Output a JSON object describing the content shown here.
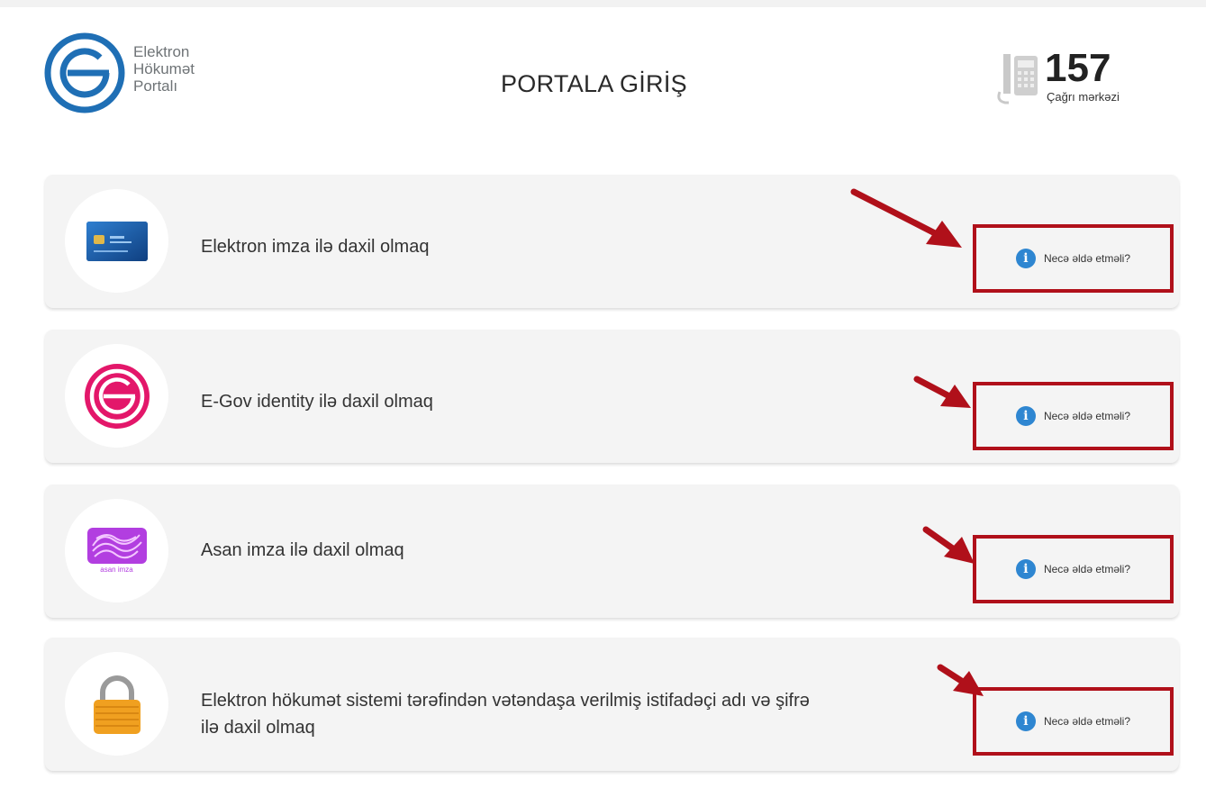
{
  "header": {
    "logo_lines": [
      "Elektron",
      "Hökumət",
      "Portalı"
    ],
    "title": "PORTALA GİRİŞ",
    "callcenter_number": "157",
    "callcenter_label": "Çağrı mərkəzi"
  },
  "login_options": [
    {
      "label": "Elektron imza ilə daxil olmaq",
      "icon": "smart-card-icon",
      "help_label": "Necə əldə etməli?"
    },
    {
      "label": "E-Gov identity ilə daxil olmaq",
      "icon": "egov-identity-icon",
      "help_label": "Necə əldə etməli?"
    },
    {
      "label": "Asan imza ilə daxil olmaq",
      "icon": "asan-imza-icon",
      "icon_caption": "asan imza",
      "help_label": "Necə əldə etməli?"
    },
    {
      "label_line1": "Elektron hökumət sistemi tərəfindən vətəndaşa verilmiş istifadəçi adı və şifrə",
      "label_line2": "ilə daxil olmaq",
      "icon": "padlock-icon",
      "help_label": "Necə əldə etməli?"
    }
  ],
  "colors": {
    "brand_blue": "#1f6fb5",
    "egov_pink": "#e3176a",
    "highlight_red": "#b0101a",
    "info_blue": "#2e86d1",
    "asan_purple": "#b23ee0"
  }
}
